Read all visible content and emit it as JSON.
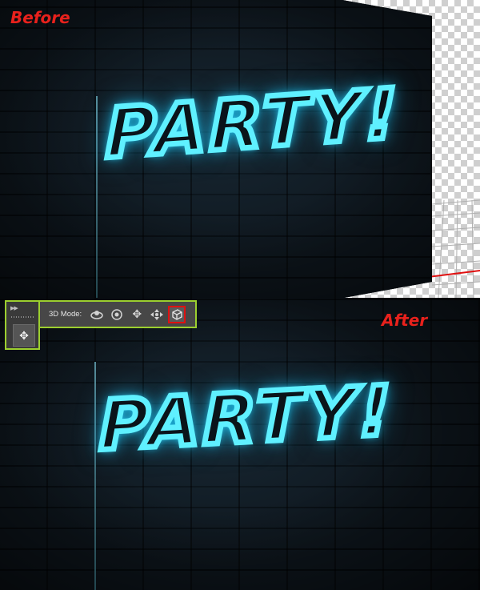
{
  "labels": {
    "before": "Before",
    "after": "After"
  },
  "neon_text": "PARTY!",
  "toolbar": {
    "mode_label": "3D Mode:",
    "icons": [
      "orbit-icon",
      "roll-icon",
      "pan-icon",
      "slide-icon",
      "scale-3d-icon"
    ],
    "selected_icon": "scale-3d-icon"
  },
  "colors": {
    "label_red": "#e8211c",
    "neon_cyan": "#5ff0ff",
    "highlight_green": "#9ccf2f",
    "selection_red": "#e01010",
    "wall_dark": "#0d141a"
  }
}
